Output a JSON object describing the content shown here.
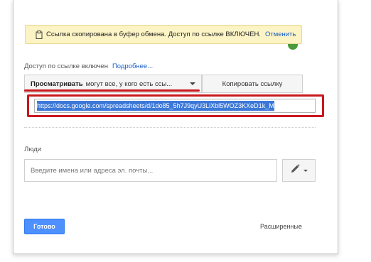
{
  "toast": {
    "message": "Ссылка скопирована в буфер обмена. Доступ по ссылке ВКЛЮЧЕН.",
    "undo_label": "Отменить"
  },
  "access": {
    "status_text": "Доступ по ссылке включен",
    "more_link": "Подробнее..."
  },
  "permission": {
    "bold_label": "Просматривать",
    "rest_label": "могут все, у кого есть ссы..."
  },
  "copy_link_label": "Копировать ссылку",
  "link_url": "https://docs.google.com/spreadsheets/d/1do85_5h7J9qyU3LiXbl5WOZ3KXeD1k_M",
  "people": {
    "label": "Люди",
    "placeholder": "Введите имена или адреса эл. почты..."
  },
  "done_label": "Готово",
  "advanced_label": "Расширенные",
  "colors": {
    "annotation_red": "#c8181e",
    "primary_blue": "#4d90fe",
    "toast_bg": "#fdf4c5",
    "selection_blue": "#3c78d8"
  },
  "icons": {
    "toast": "clipboard-icon",
    "edit": "pencil-icon"
  }
}
